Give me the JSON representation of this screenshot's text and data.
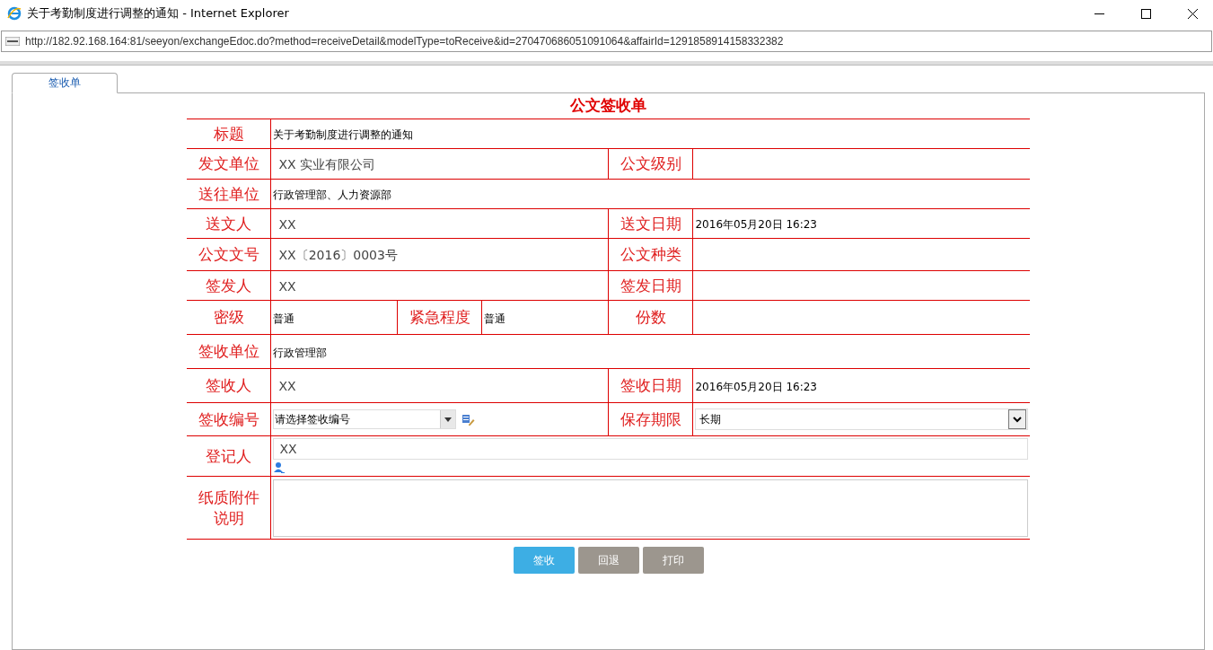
{
  "window": {
    "title": "关于考勤制度进行调整的通知 - Internet Explorer"
  },
  "address_bar": {
    "url": "http://182.92.168.164:81/seeyon/exchangeEdoc.do?method=receiveDetail&modelType=toReceive&id=270470686051091064&affairId=1291858914158332382"
  },
  "tabs": [
    {
      "label": "签收单",
      "selected": true
    }
  ],
  "form": {
    "title": "公文签收单",
    "rows": [
      {
        "cells": [
          {
            "kind": "label",
            "text": "标题"
          },
          {
            "kind": "text",
            "text": "关于考勤制度进行调整的通知",
            "colspan": 5
          }
        ]
      },
      {
        "cells": [
          {
            "kind": "label",
            "text": "发文单位"
          },
          {
            "kind": "name",
            "text": "XX 实业有限公司",
            "colspan": 3
          },
          {
            "kind": "label",
            "text": "公文级别"
          },
          {
            "kind": "text"
          }
        ]
      },
      {
        "cells": [
          {
            "kind": "label",
            "text": "送往单位"
          },
          {
            "kind": "text",
            "text": "行政管理部、人力资源部",
            "colspan": 5
          }
        ]
      },
      {
        "cells": [
          {
            "kind": "label",
            "text": "送文人"
          },
          {
            "kind": "name",
            "text": "XX",
            "colspan": 3
          },
          {
            "kind": "label",
            "text": "送文日期"
          },
          {
            "kind": "text",
            "text": "2016年05月20日 16:23"
          }
        ]
      },
      {
        "cells": [
          {
            "kind": "label",
            "text": "公文文号"
          },
          {
            "kind": "name",
            "text": "XX〔2016〕0003号",
            "colspan": 3
          },
          {
            "kind": "label",
            "text": "公文种类"
          },
          {
            "kind": "text"
          }
        ]
      },
      {
        "cells": [
          {
            "kind": "label",
            "text": "签发人"
          },
          {
            "kind": "name",
            "text": "XX",
            "colspan": 3
          },
          {
            "kind": "label",
            "text": "签发日期"
          },
          {
            "kind": "text"
          }
        ]
      },
      {
        "cells": [
          {
            "kind": "label",
            "text": "密级"
          },
          {
            "kind": "text",
            "text": "普通"
          },
          {
            "kind": "label",
            "text": "紧急程度"
          },
          {
            "kind": "text",
            "text": "普通"
          },
          {
            "kind": "label",
            "text": "份数"
          },
          {
            "kind": "text"
          }
        ]
      },
      {
        "cells": [
          {
            "kind": "label",
            "text": "签收单位"
          },
          {
            "kind": "text",
            "text": "行政管理部",
            "colspan": 5
          }
        ]
      },
      {
        "cells": [
          {
            "kind": "label",
            "text": "签收人"
          },
          {
            "kind": "name",
            "text": "XX",
            "colspan": 3
          },
          {
            "kind": "label",
            "text": "签收日期"
          },
          {
            "kind": "text",
            "text": "2016年05月20日 16:23"
          }
        ]
      },
      {
        "cells": [
          {
            "kind": "label",
            "text": "签收编号"
          },
          {
            "kind": "combo",
            "value": "请选择签收编号",
            "colspan": 3
          },
          {
            "kind": "label",
            "text": "保存期限"
          },
          {
            "kind": "dropdown",
            "value": "长期"
          }
        ]
      },
      {
        "cells": [
          {
            "kind": "label",
            "text": "登记人"
          },
          {
            "kind": "person",
            "value": "XX",
            "colspan": 5
          }
        ]
      },
      {
        "cells": [
          {
            "kind": "label",
            "text": "纸质附件说明"
          },
          {
            "kind": "textarea",
            "colspan": 5
          }
        ]
      }
    ]
  },
  "buttons": [
    {
      "label": "签收",
      "kind": "primary"
    },
    {
      "label": "回退",
      "kind": "secondary"
    },
    {
      "label": "打印",
      "kind": "secondary"
    }
  ]
}
